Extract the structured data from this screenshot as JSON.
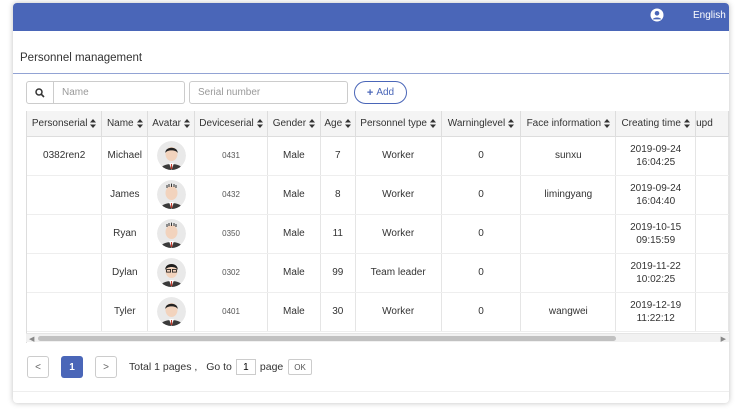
{
  "header": {
    "language": "English"
  },
  "page": {
    "title": "Personnel management"
  },
  "filters": {
    "name_placeholder": "Name",
    "serial_placeholder": "Serial number",
    "add_label": "Add"
  },
  "table": {
    "columns": [
      "Personserial",
      "Name",
      "Avatar",
      "Deviceserial",
      "Gender",
      "Age",
      "Personnel type",
      "Warninglevel",
      "Face information",
      "Creating time",
      "upd"
    ],
    "rows": [
      {
        "personserial": "0382ren2",
        "name": "Michael",
        "avatar": "avatar-suit",
        "deviceserial": "0431",
        "gender": "Male",
        "age": "7",
        "type": "Worker",
        "warning": "0",
        "face": "sunxu",
        "date": "2019-09-24",
        "time": "16:04:25"
      },
      {
        "personserial": "",
        "name": "James",
        "avatar": "avatar-bald",
        "deviceserial": "0432",
        "gender": "Male",
        "age": "8",
        "type": "Worker",
        "warning": "0",
        "face": "limingyang",
        "date": "2019-09-24",
        "time": "16:04:40"
      },
      {
        "personserial": "",
        "name": "Ryan",
        "avatar": "avatar-bald",
        "deviceserial": "0350",
        "gender": "Male",
        "age": "11",
        "type": "Worker",
        "warning": "0",
        "face": "",
        "date": "2019-10-15",
        "time": "09:15:59"
      },
      {
        "personserial": "",
        "name": "Dylan",
        "avatar": "avatar-glasses",
        "deviceserial": "0302",
        "gender": "Male",
        "age": "99",
        "type": "Team leader",
        "warning": "0",
        "face": "",
        "date": "2019-11-22",
        "time": "10:02:25"
      },
      {
        "personserial": "",
        "name": "Tyler",
        "avatar": "avatar-suit",
        "deviceserial": "0401",
        "gender": "Male",
        "age": "30",
        "type": "Worker",
        "warning": "0",
        "face": "wangwei",
        "date": "2019-12-19",
        "time": "11:22:12"
      }
    ]
  },
  "pagination": {
    "prev": "<",
    "current": "1",
    "next": ">",
    "total_text": "Total 1 pages , ",
    "goto_text": "Go to",
    "goto_value": "1",
    "page_text": "page",
    "ok_label": "OK"
  },
  "colors": {
    "accent": "#4a66b8",
    "header_bg": "#f4f4f4"
  }
}
